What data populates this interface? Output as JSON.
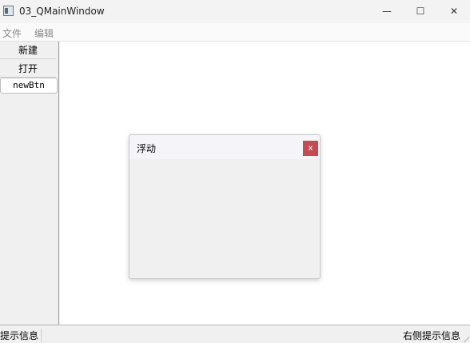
{
  "window": {
    "title": "03_QMainWindow",
    "minimize": "—",
    "maximize": "☐",
    "close": "✕"
  },
  "menubar": {
    "items": [
      "文件",
      "编辑"
    ]
  },
  "left_dock": {
    "buttons": [
      "新建",
      "打开",
      "newBtn"
    ]
  },
  "floating_dock": {
    "title": "浮动",
    "close_label": "x",
    "close_color": "#c44a53"
  },
  "statusbar": {
    "left_text": "提示信息",
    "right_text": "右侧提示信息"
  }
}
